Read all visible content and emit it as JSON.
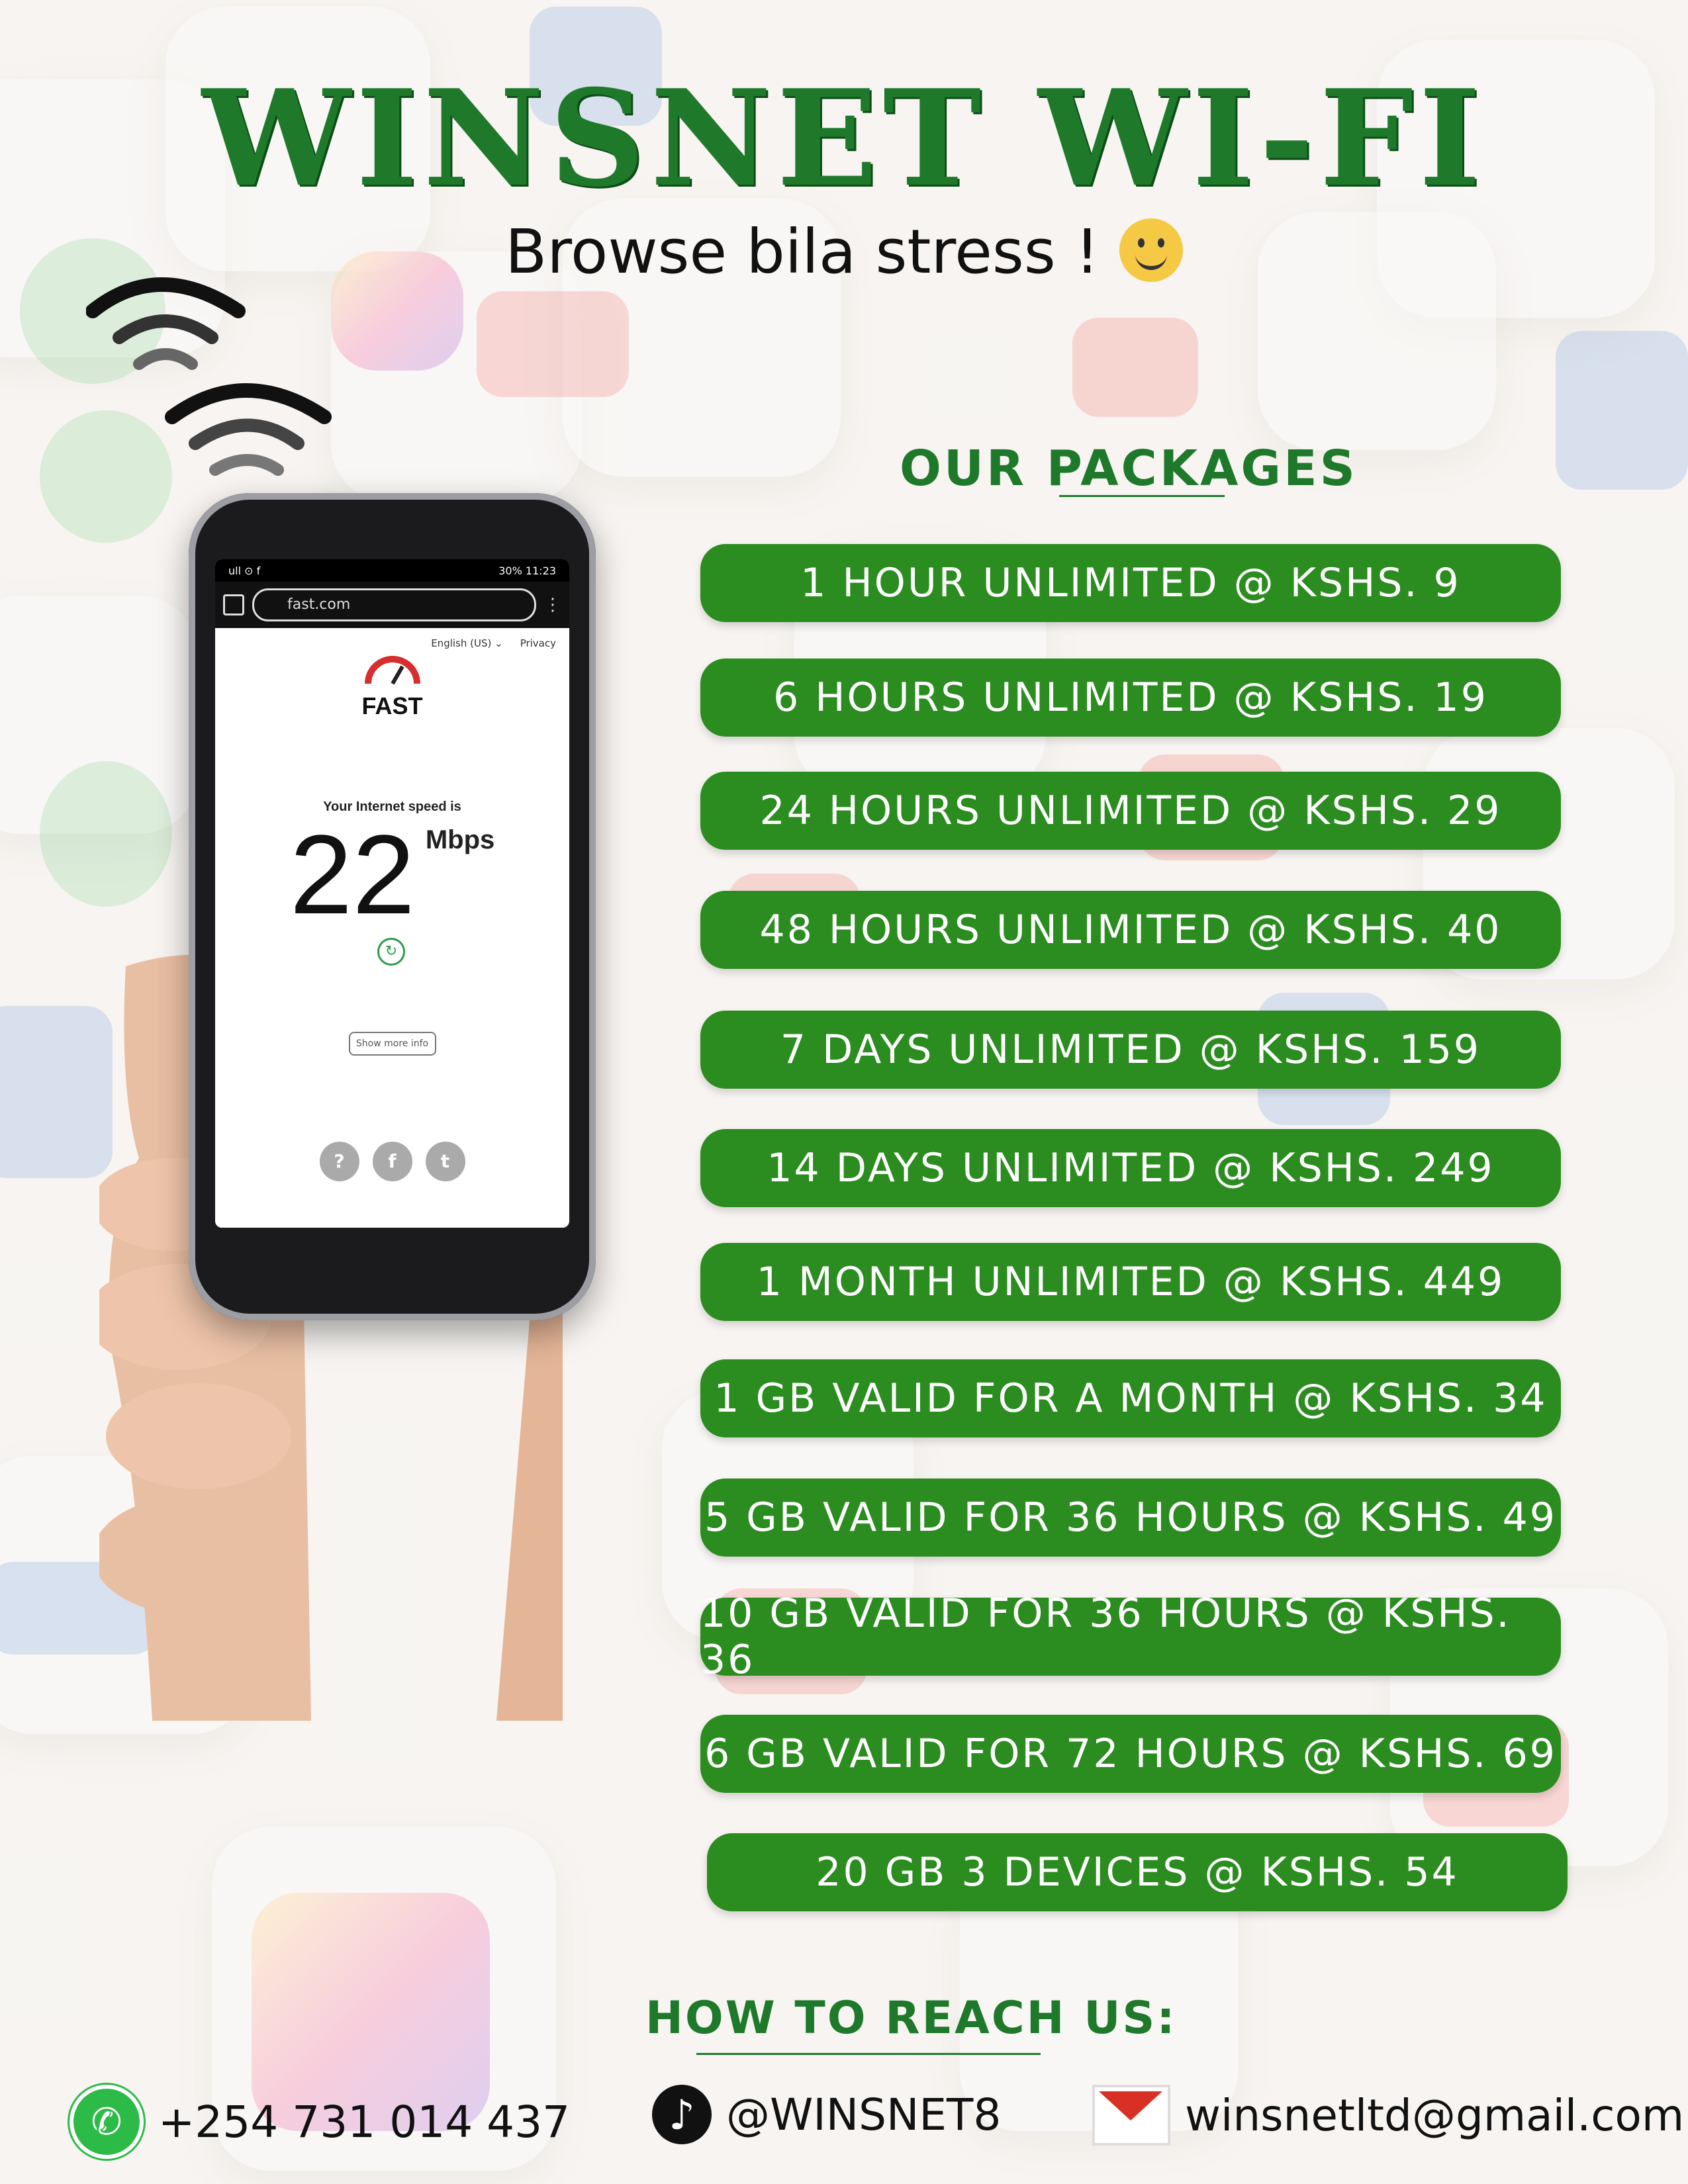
{
  "header": {
    "title": "WINSNET WI-FI",
    "tagline": "Browse bila stress !"
  },
  "phone": {
    "status_left": "ull ⊙ f",
    "status_right": "30% 11:23",
    "url": "fast.com",
    "nav_language": "English (US) ⌄",
    "nav_privacy": "Privacy",
    "logo": "FAST",
    "speed_label": "Your Internet speed is",
    "speed_value": "22",
    "speed_unit": "Mbps",
    "more_info": "Show more info"
  },
  "packages": {
    "heading": "OUR PACKAGES",
    "items": [
      "1 HOUR UNLIMITED @ KSHS. 9",
      "6 HOURS UNLIMITED @ KSHS. 19",
      "24 HOURS UNLIMITED @ KSHS. 29",
      "48 HOURS UNLIMITED @ KSHS. 40",
      "7 DAYS UNLIMITED @ KSHS. 159",
      "14 DAYS UNLIMITED @ KSHS. 249",
      "1 MONTH UNLIMITED @ KSHS. 449",
      "1 GB VALID FOR A MONTH @ KSHS. 34",
      "5 GB VALID FOR 36 HOURS @ KSHS. 49",
      "10 GB VALID FOR 36 HOURS @ KSHS. 36",
      "6 GB VALID FOR 72 HOURS @ KSHS. 69",
      "20 GB 3 DEVICES @ KSHS. 54"
    ]
  },
  "contacts": {
    "heading": "HOW TO REACH US:",
    "phone": "+254 731 014 437",
    "tiktok": "@WINSNET8",
    "email": "winsnetltd@gmail.com"
  },
  "colors": {
    "brand_green": "#1e7a2a",
    "package_green": "#2b8c1f"
  }
}
